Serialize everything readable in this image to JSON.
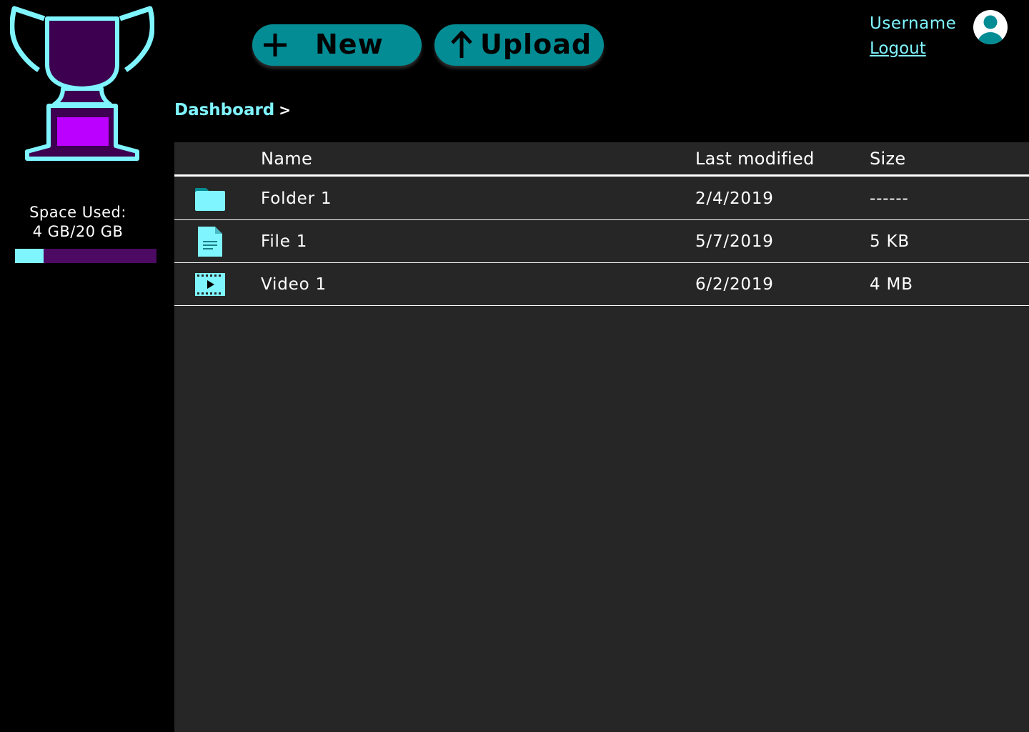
{
  "sidebar": {
    "space_title": "Space Used:",
    "space_value": "4 GB/20 GB",
    "space_used_fraction": 0.2
  },
  "toolbar": {
    "new_label": "New",
    "upload_label": "Upload"
  },
  "user": {
    "username": "Username",
    "logout_label": "Logout"
  },
  "breadcrumb": {
    "current": "Dashboard",
    "separator": ">"
  },
  "table": {
    "headers": {
      "name": "Name",
      "modified": "Last modified",
      "size": "Size"
    },
    "rows": [
      {
        "icon": "folder-icon",
        "name": "Folder 1",
        "modified": "2/4/2019",
        "size": "------"
      },
      {
        "icon": "file-icon",
        "name": "File 1",
        "modified": "5/7/2019",
        "size": "5 KB"
      },
      {
        "icon": "video-icon",
        "name": "Video 1",
        "modified": "6/2/2019",
        "size": "4 MB"
      }
    ]
  },
  "colors": {
    "accent": "#7ff5ff",
    "button": "#038c94",
    "brand_purple": "#3d0050",
    "brand_magenta": "#bb00ff",
    "panel": "#262626"
  }
}
